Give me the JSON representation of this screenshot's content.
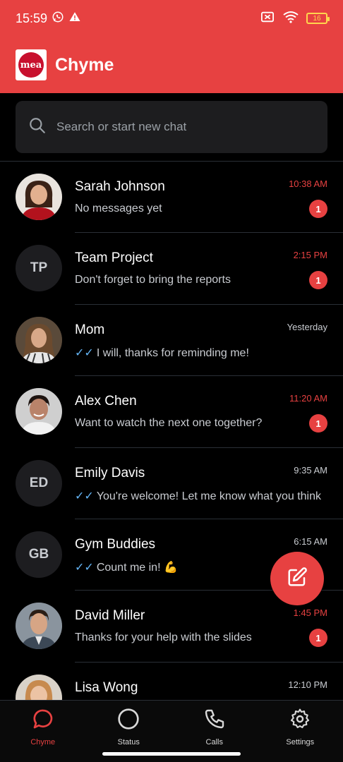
{
  "status": {
    "time": "15:59",
    "battery": "16"
  },
  "app": {
    "title": "Chyme",
    "logo_text": "mea"
  },
  "search": {
    "placeholder": "Search or start new chat"
  },
  "chats": [
    {
      "name": "Sarah Johnson",
      "message": "No messages yet",
      "time": "10:38 AM",
      "unread": "1"
    },
    {
      "name": "Team Project",
      "initials": "TP",
      "message": "Don't forget to bring the reports",
      "time": "2:15 PM",
      "unread": "1"
    },
    {
      "name": "Mom",
      "message": "I will, thanks for reminding me!",
      "time": "Yesterday",
      "read": "✓✓"
    },
    {
      "name": "Alex Chen",
      "message": "Want to watch the next one together?",
      "time": "11:20 AM",
      "unread": "1"
    },
    {
      "name": "Emily Davis",
      "initials": "ED",
      "message": "You're welcome! Let me know what you think",
      "time": "9:35 AM",
      "read": "✓✓"
    },
    {
      "name": "Gym Buddies",
      "initials": "GB",
      "message": "Count me in! 💪",
      "time": "6:15 AM",
      "read": "✓✓"
    },
    {
      "name": "David Miller",
      "message": "Thanks for your help with the slides",
      "time": "1:45 PM",
      "unread": "1"
    },
    {
      "name": "Lisa Wong",
      "message": "",
      "time": "12:10 PM"
    }
  ],
  "nav": [
    {
      "label": "Chyme",
      "icon": "chat-bubble-icon",
      "active": true
    },
    {
      "label": "Status",
      "icon": "status-circle-icon"
    },
    {
      "label": "Calls",
      "icon": "phone-icon"
    },
    {
      "label": "Settings",
      "icon": "gear-icon"
    }
  ],
  "colors": {
    "accent": "#e74141",
    "background": "#000000",
    "surface": "#1d1d1f",
    "read_ticks": "#64b5f6"
  }
}
